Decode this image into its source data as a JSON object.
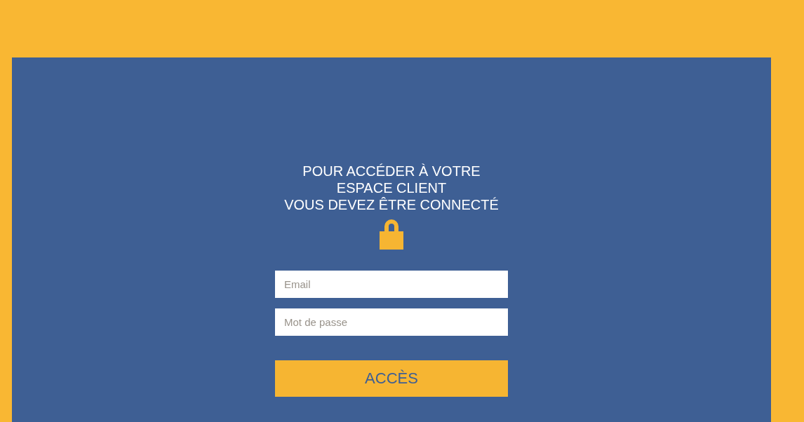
{
  "login": {
    "heading_lines": [
      "POUR ACCÉDER À VOTRE",
      "ESPACE CLIENT",
      "VOUS DEVEZ ÊTRE CONNECTÉ"
    ],
    "fields": [
      {
        "placeholder": "Email"
      },
      {
        "placeholder": "Mot de passe"
      }
    ],
    "button": "ACCÈS"
  }
}
